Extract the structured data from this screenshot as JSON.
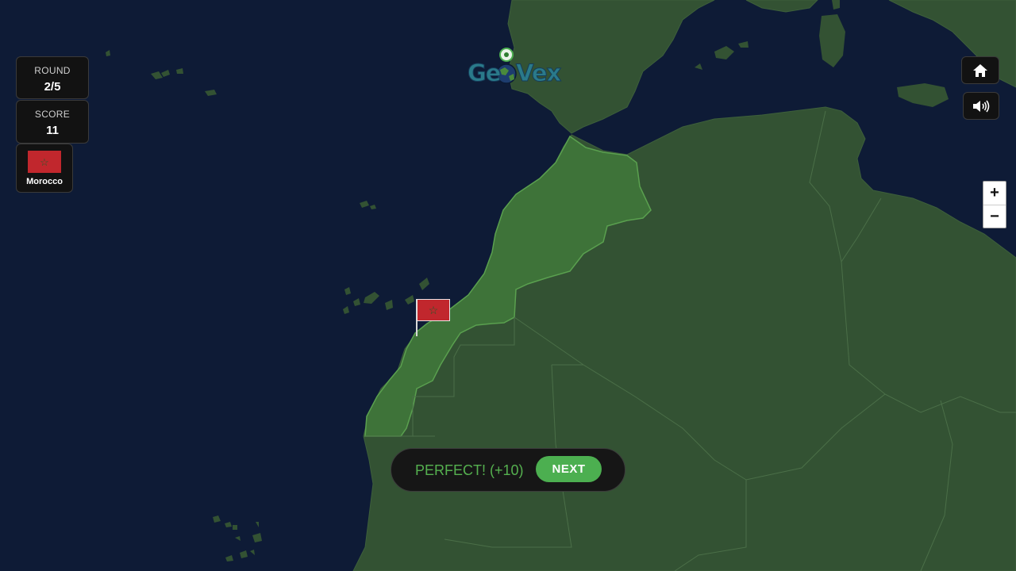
{
  "hud": {
    "round_label": "ROUND",
    "round_value": "2/5",
    "score_label": "SCORE",
    "score_value": "11",
    "country_name": "Morocco"
  },
  "logo": {
    "text_left": "Ge",
    "text_right": "Vex"
  },
  "result": {
    "message": "PERFECT! (+10)",
    "next_label": "NEXT"
  },
  "controls": {
    "home_icon": "home-icon",
    "sound_icon": "speaker-icon",
    "zoom_in_label": "+",
    "zoom_out_label": "−"
  },
  "colors": {
    "ocean": "#0e1b36",
    "land": "#335233",
    "highlight": "#3e7339",
    "success": "#4caf50",
    "flag_red": "#c1272d",
    "flag_star": "#1f5c2b"
  },
  "flag_icon": "star"
}
